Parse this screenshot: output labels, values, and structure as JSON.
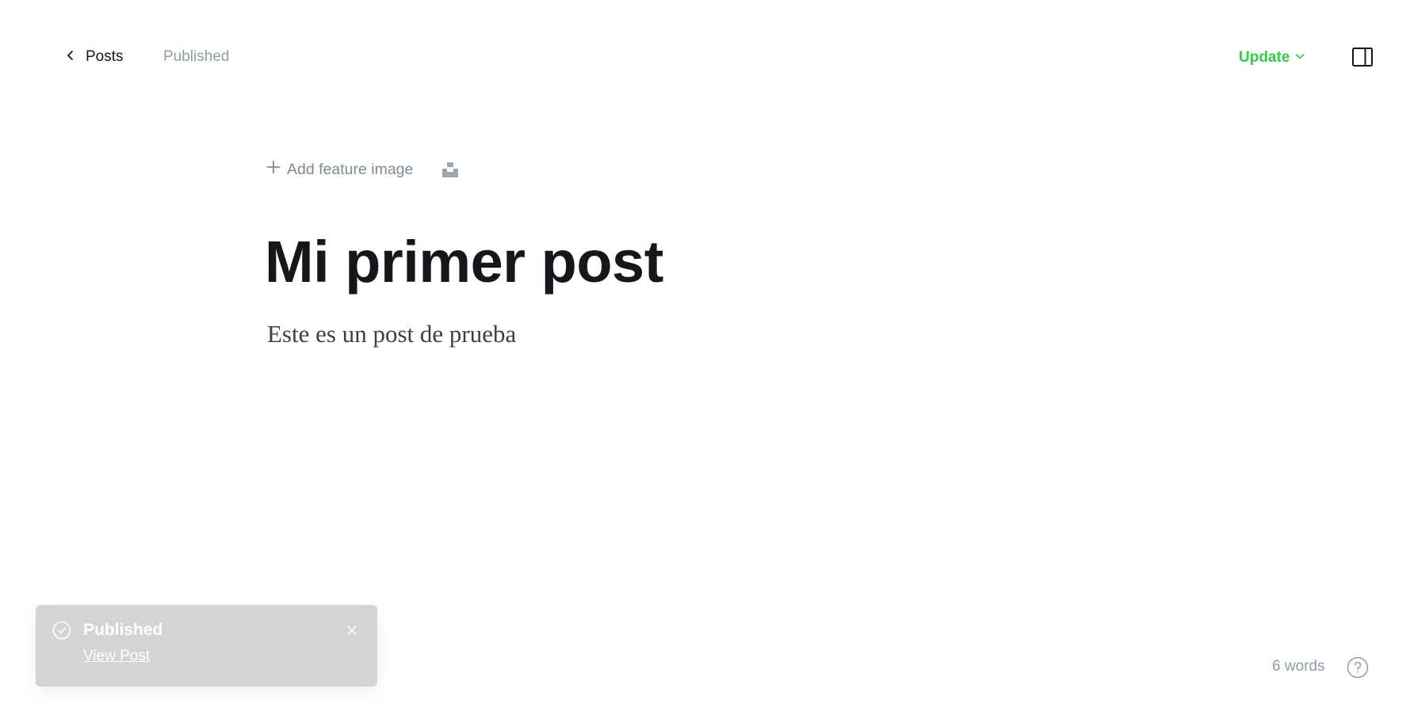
{
  "topbar": {
    "back_label": "Posts",
    "status": "Published",
    "update_label": "Update"
  },
  "editor": {
    "add_feature_image": "Add feature image",
    "title": "Mi primer post",
    "body": "Este es un post de prueba"
  },
  "toast": {
    "title": "Published",
    "link": "View Post"
  },
  "footer": {
    "word_count": "6 words"
  },
  "colors": {
    "accent_green": "#30cf43",
    "muted_text": "#8e9cac",
    "toast_bg": "#d4d4d4",
    "title_text": "#15171a"
  },
  "icons": [
    "chevron-left-icon",
    "chevron-down-icon",
    "sidebar-toggle-icon",
    "plus-icon",
    "unsplash-icon",
    "check-circle-icon",
    "close-icon",
    "help-icon"
  ]
}
